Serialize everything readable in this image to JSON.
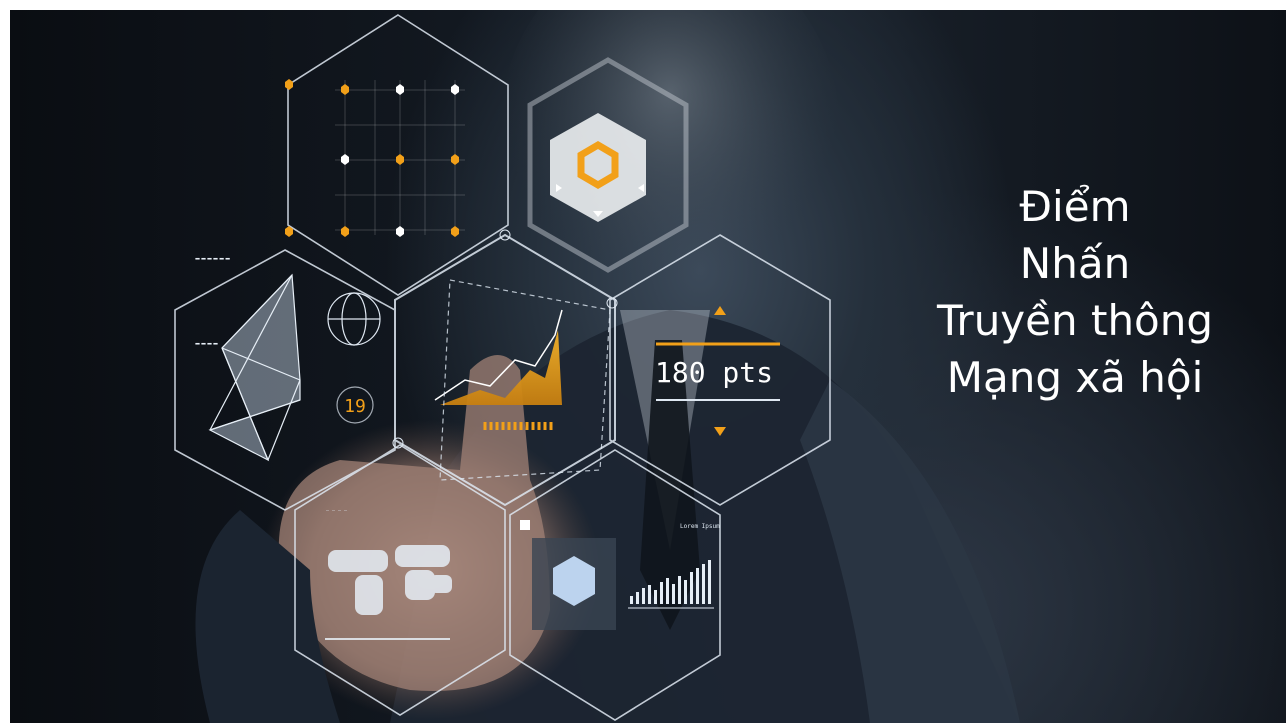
{
  "slide": {
    "text_lines": [
      "Điểm",
      "Nhấn",
      "Truyền thông",
      "Mạng xã hội"
    ]
  },
  "image": {
    "pts_readout": "180 pts",
    "number_readout": "19",
    "panel_title": "Lorem Ipsum"
  },
  "colors": {
    "background": "#121820",
    "text": "#ffffff",
    "accent": "#f2a019",
    "hud_line": "#dfe8f2"
  },
  "icons": [
    "hexagon-icon",
    "world-map-icon",
    "bar-chart-icon",
    "network-graph-icon",
    "globe-icon"
  ]
}
